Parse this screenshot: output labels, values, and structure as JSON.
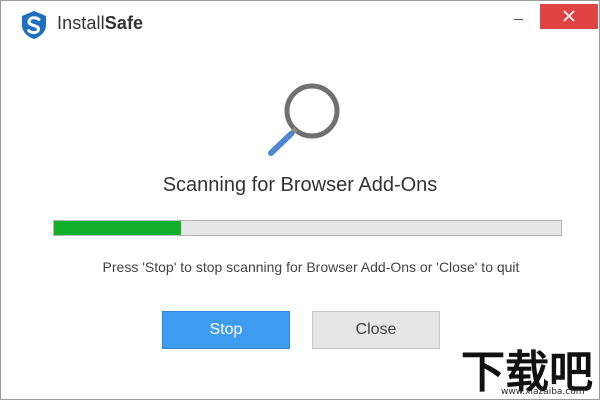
{
  "app": {
    "name_regular": "Install",
    "name_bold": "Safe",
    "logo_icon": "installsafe-shield-s-icon"
  },
  "window_controls": {
    "minimize_icon": "minimize-icon",
    "close_icon": "close-x-icon",
    "close_color": "#e04343"
  },
  "scan": {
    "icon": "magnifier-icon",
    "title": "Scanning for Browser Add-Ons",
    "progress_fraction": 0.25,
    "progress_color": "#13b12a",
    "message": "Press 'Stop' to stop scanning for Browser Add-Ons or 'Close' to quit"
  },
  "buttons": {
    "stop_label": "Stop",
    "close_label": "Close",
    "stop_color": "#3e9cf0"
  },
  "watermark": {
    "text": "下载吧",
    "url": "www.xiazaiba.com"
  }
}
